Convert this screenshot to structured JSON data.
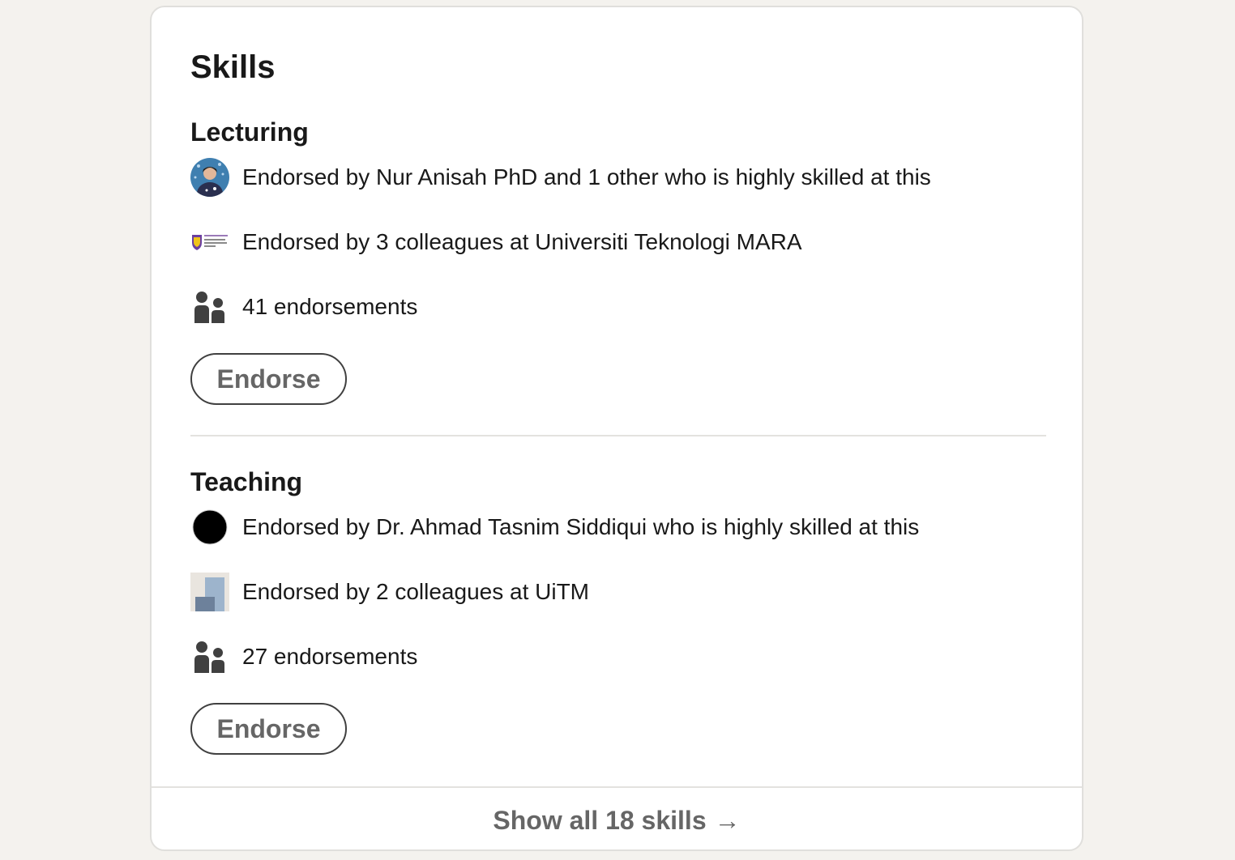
{
  "section": {
    "title": "Skills"
  },
  "skills": [
    {
      "name": "Lecturing",
      "endorsed_by_highly_skilled": "Endorsed by Nur Anisah PhD and 1 other who is highly skilled at this",
      "endorsed_by_colleagues": "Endorsed by 3 colleagues at Universiti Teknologi MARA",
      "endorsement_count": "41 endorsements",
      "endorse_label": "Endorse"
    },
    {
      "name": "Teaching",
      "endorsed_by_highly_skilled": "Endorsed by Dr. Ahmad Tasnim Siddiqui who is highly skilled at this",
      "endorsed_by_colleagues": "Endorsed by 2 colleagues at UiTM",
      "endorsement_count": "27 endorsements",
      "endorse_label": "Endorse"
    }
  ],
  "footer": {
    "show_all_label": "Show all 18 skills",
    "arrow": "→"
  },
  "icons": {
    "people": "people-icon",
    "avatar_photo": "endorser-avatar",
    "avatar_black": "endorser-avatar-black",
    "org_logo_uitm": "uitm-logo",
    "org_logo_placeholder": "company-logo-placeholder"
  },
  "colors": {
    "page_bg": "#f4f2ee",
    "text": "#191919",
    "muted_text": "#666666",
    "icon": "#404040"
  }
}
